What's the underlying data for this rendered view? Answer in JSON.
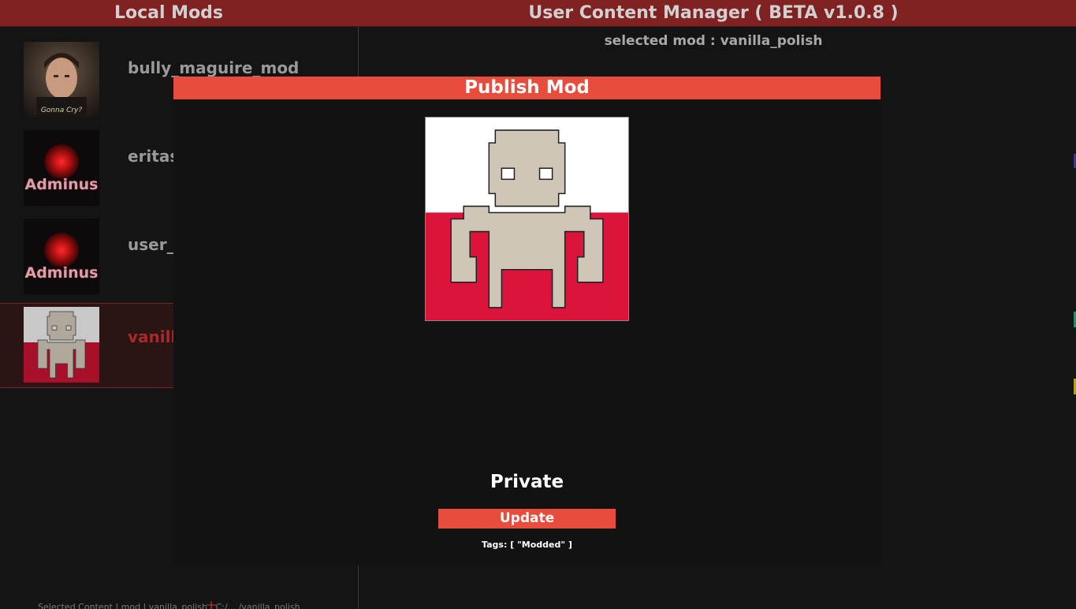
{
  "header": {
    "left_title": "Local Mods",
    "right_title": "User Content Manager ( BETA v1.0.8 )"
  },
  "selected_mod_label": "selected mod : vanilla_polish",
  "mods": [
    {
      "name": "bully_maguire_mod",
      "thumb_caption": "Gonna Cry?",
      "icon": "face-photo-thumbnail"
    },
    {
      "name": "eritas",
      "thumb_caption": "Adminus",
      "icon": "adminus-thumbnail"
    },
    {
      "name": "user_c",
      "thumb_caption": "Adminus",
      "icon": "adminus-thumbnail"
    },
    {
      "name": "vanilla",
      "selected": true,
      "icon": "polish-robot-thumbnail"
    }
  ],
  "modal": {
    "title": "Publish Mod",
    "visibility": "Private",
    "update_button": "Update",
    "tags": "Tags: [ \"Modded\" ]"
  },
  "status_bar": "Selected Content | mod | vanilla_polish | C:/... /vanilla_polish",
  "colors": {
    "header_bg": "#802222",
    "modal_accent": "#e74c3c",
    "flag_white": "#ffffff",
    "flag_red": "#dc143c",
    "robot_body": "#d0c6b8"
  }
}
